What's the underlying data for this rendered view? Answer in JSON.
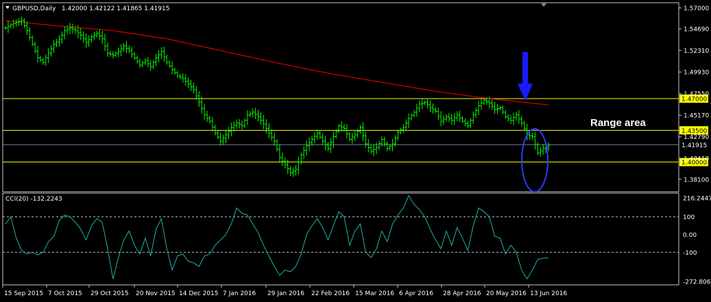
{
  "header": {
    "symbol": "GBPUSD,Daily",
    "ohlc": "1.42000 1.42122 1.41865 1.41915"
  },
  "indicator": {
    "label": "CCI(20) -132.2243",
    "ticks": [
      "216.2447",
      "100",
      "0.00",
      "-100",
      "-272.8061"
    ]
  },
  "annotation": {
    "range_label": "Range area"
  },
  "colors": {
    "background": "#000000",
    "candle": "#00ff00",
    "ma": "#ff0000",
    "level_line": "#ffff00",
    "current_line": "#6f7fa8",
    "cci_line": "#20b2aa",
    "arrow": "#1a1aff",
    "ellipse": "#2a3cff"
  },
  "chart_data": [
    {
      "type": "candlestick",
      "title": "GBPUSD,Daily",
      "ylim": [
        1.368,
        1.575
      ],
      "ytick_labels": [
        "1.57000",
        "1.54690",
        "1.52310",
        "1.49930",
        "1.47550",
        "1.45170",
        "1.42790",
        "1.40410",
        "1.38100"
      ],
      "xtick_labels": [
        "15 Sep 2015",
        "7 Oct 2015",
        "29 Oct 2015",
        "20 Nov 2015",
        "14 Dec 2015",
        "7 Jan 2016",
        "29 Jan 2016",
        "22 Feb 2016",
        "15 Mar 2016",
        "6 Apr 2016",
        "28 Apr 2016",
        "20 May 2016",
        "13 Jun 2016"
      ],
      "close_path": [
        [
          0,
          1.548
        ],
        [
          3,
          1.553
        ],
        [
          6,
          1.556
        ],
        [
          8,
          1.545
        ],
        [
          10,
          1.53
        ],
        [
          12,
          1.515
        ],
        [
          14,
          1.51
        ],
        [
          16,
          1.52
        ],
        [
          18,
          1.53
        ],
        [
          20,
          1.535
        ],
        [
          22,
          1.545
        ],
        [
          24,
          1.548
        ],
        [
          26,
          1.545
        ],
        [
          28,
          1.54
        ],
        [
          30,
          1.532
        ],
        [
          32,
          1.538
        ],
        [
          34,
          1.542
        ],
        [
          36,
          1.536
        ],
        [
          38,
          1.52
        ],
        [
          40,
          1.518
        ],
        [
          42,
          1.522
        ],
        [
          44,
          1.528
        ],
        [
          46,
          1.523
        ],
        [
          48,
          1.515
        ],
        [
          50,
          1.507
        ],
        [
          52,
          1.512
        ],
        [
          54,
          1.505
        ],
        [
          56,
          1.515
        ],
        [
          58,
          1.522
        ],
        [
          60,
          1.51
        ],
        [
          62,
          1.502
        ],
        [
          64,
          1.495
        ],
        [
          66,
          1.492
        ],
        [
          68,
          1.486
        ],
        [
          70,
          1.48
        ],
        [
          72,
          1.466
        ],
        [
          74,
          1.452
        ],
        [
          76,
          1.445
        ],
        [
          78,
          1.432
        ],
        [
          80,
          1.423
        ],
        [
          82,
          1.43
        ],
        [
          84,
          1.438
        ],
        [
          86,
          1.443
        ],
        [
          88,
          1.44
        ],
        [
          90,
          1.452
        ],
        [
          92,
          1.455
        ],
        [
          94,
          1.45
        ],
        [
          96,
          1.442
        ],
        [
          98,
          1.432
        ],
        [
          100,
          1.423
        ],
        [
          102,
          1.405
        ],
        [
          104,
          1.397
        ],
        [
          106,
          1.388
        ],
        [
          108,
          1.392
        ],
        [
          110,
          1.408
        ],
        [
          112,
          1.418
        ],
        [
          114,
          1.425
        ],
        [
          116,
          1.432
        ],
        [
          118,
          1.423
        ],
        [
          120,
          1.415
        ],
        [
          122,
          1.428
        ],
        [
          124,
          1.44
        ],
        [
          126,
          1.437
        ],
        [
          128,
          1.425
        ],
        [
          130,
          1.43
        ],
        [
          132,
          1.438
        ],
        [
          134,
          1.42
        ],
        [
          136,
          1.412
        ],
        [
          138,
          1.416
        ],
        [
          140,
          1.425
        ],
        [
          142,
          1.415
        ],
        [
          144,
          1.42
        ],
        [
          146,
          1.433
        ],
        [
          148,
          1.438
        ],
        [
          150,
          1.448
        ],
        [
          152,
          1.455
        ],
        [
          154,
          1.464
        ],
        [
          156,
          1.466
        ],
        [
          158,
          1.46
        ],
        [
          160,
          1.456
        ],
        [
          162,
          1.445
        ],
        [
          164,
          1.45
        ],
        [
          166,
          1.446
        ],
        [
          168,
          1.452
        ],
        [
          170,
          1.445
        ],
        [
          172,
          1.44
        ],
        [
          174,
          1.452
        ],
        [
          176,
          1.462
        ],
        [
          178,
          1.468
        ],
        [
          180,
          1.465
        ],
        [
          182,
          1.458
        ],
        [
          184,
          1.46
        ],
        [
          186,
          1.45
        ],
        [
          188,
          1.446
        ],
        [
          190,
          1.452
        ],
        [
          192,
          1.443
        ],
        [
          194,
          1.43
        ],
        [
          196,
          1.428
        ],
        [
          198,
          1.41
        ],
        [
          200,
          1.415
        ],
        [
          202,
          1.418
        ]
      ],
      "moving_average": [
        [
          0,
          1.556
        ],
        [
          20,
          1.55
        ],
        [
          40,
          1.545
        ],
        [
          60,
          1.536
        ],
        [
          80,
          1.523
        ],
        [
          100,
          1.51
        ],
        [
          120,
          1.498
        ],
        [
          140,
          1.488
        ],
        [
          160,
          1.478
        ],
        [
          180,
          1.47
        ],
        [
          202,
          1.463
        ]
      ],
      "horizontal_levels": [
        {
          "value": 1.47,
          "label": "1.47000"
        },
        {
          "value": 1.435,
          "label": "1.43500"
        },
        {
          "value": 1.4,
          "label": "1.40000"
        }
      ],
      "current_price": {
        "value": 1.41915,
        "label": "1.41915"
      }
    },
    {
      "type": "line",
      "title": "CCI(20) -132.2243",
      "ylim": [
        -280,
        230
      ],
      "levels": [
        100,
        -100
      ],
      "values": [
        [
          0,
          60
        ],
        [
          2,
          100
        ],
        [
          4,
          -20
        ],
        [
          6,
          -90
        ],
        [
          8,
          -110
        ],
        [
          10,
          -100
        ],
        [
          12,
          -115
        ],
        [
          14,
          -100
        ],
        [
          16,
          -40
        ],
        [
          18,
          -10
        ],
        [
          20,
          80
        ],
        [
          22,
          110
        ],
        [
          24,
          100
        ],
        [
          26,
          70
        ],
        [
          28,
          30
        ],
        [
          30,
          -30
        ],
        [
          32,
          50
        ],
        [
          34,
          90
        ],
        [
          36,
          70
        ],
        [
          38,
          -80
        ],
        [
          40,
          -250
        ],
        [
          42,
          -130
        ],
        [
          44,
          -30
        ],
        [
          46,
          20
        ],
        [
          48,
          -60
        ],
        [
          50,
          -110
        ],
        [
          52,
          -20
        ],
        [
          54,
          -120
        ],
        [
          56,
          30
        ],
        [
          58,
          90
        ],
        [
          60,
          -80
        ],
        [
          62,
          -200
        ],
        [
          64,
          -120
        ],
        [
          66,
          -110
        ],
        [
          68,
          -150
        ],
        [
          70,
          -160
        ],
        [
          72,
          -180
        ],
        [
          74,
          -120
        ],
        [
          76,
          -110
        ],
        [
          78,
          -60
        ],
        [
          80,
          -30
        ],
        [
          82,
          0
        ],
        [
          84,
          60
        ],
        [
          86,
          150
        ],
        [
          88,
          120
        ],
        [
          90,
          110
        ],
        [
          92,
          60
        ],
        [
          94,
          10
        ],
        [
          96,
          -60
        ],
        [
          98,
          -120
        ],
        [
          100,
          -180
        ],
        [
          102,
          -230
        ],
        [
          104,
          -200
        ],
        [
          106,
          -210
        ],
        [
          108,
          -180
        ],
        [
          110,
          -110
        ],
        [
          112,
          0
        ],
        [
          114,
          50
        ],
        [
          116,
          90
        ],
        [
          118,
          40
        ],
        [
          120,
          -30
        ],
        [
          122,
          50
        ],
        [
          124,
          130
        ],
        [
          126,
          100
        ],
        [
          128,
          -60
        ],
        [
          130,
          20
        ],
        [
          132,
          60
        ],
        [
          134,
          -100
        ],
        [
          136,
          -130
        ],
        [
          138,
          -80
        ],
        [
          140,
          20
        ],
        [
          142,
          -40
        ],
        [
          144,
          60
        ],
        [
          146,
          110
        ],
        [
          148,
          150
        ],
        [
          150,
          220
        ],
        [
          152,
          170
        ],
        [
          154,
          140
        ],
        [
          156,
          100
        ],
        [
          158,
          30
        ],
        [
          160,
          -30
        ],
        [
          162,
          -80
        ],
        [
          164,
          20
        ],
        [
          166,
          -60
        ],
        [
          168,
          40
        ],
        [
          170,
          -20
        ],
        [
          172,
          -90
        ],
        [
          174,
          50
        ],
        [
          176,
          150
        ],
        [
          178,
          130
        ],
        [
          180,
          100
        ],
        [
          182,
          -10
        ],
        [
          184,
          -20
        ],
        [
          186,
          -110
        ],
        [
          188,
          -60
        ],
        [
          190,
          -100
        ],
        [
          192,
          -200
        ],
        [
          194,
          -250
        ],
        [
          196,
          -200
        ],
        [
          198,
          -140
        ],
        [
          200,
          -133
        ],
        [
          202,
          -132
        ]
      ]
    }
  ]
}
